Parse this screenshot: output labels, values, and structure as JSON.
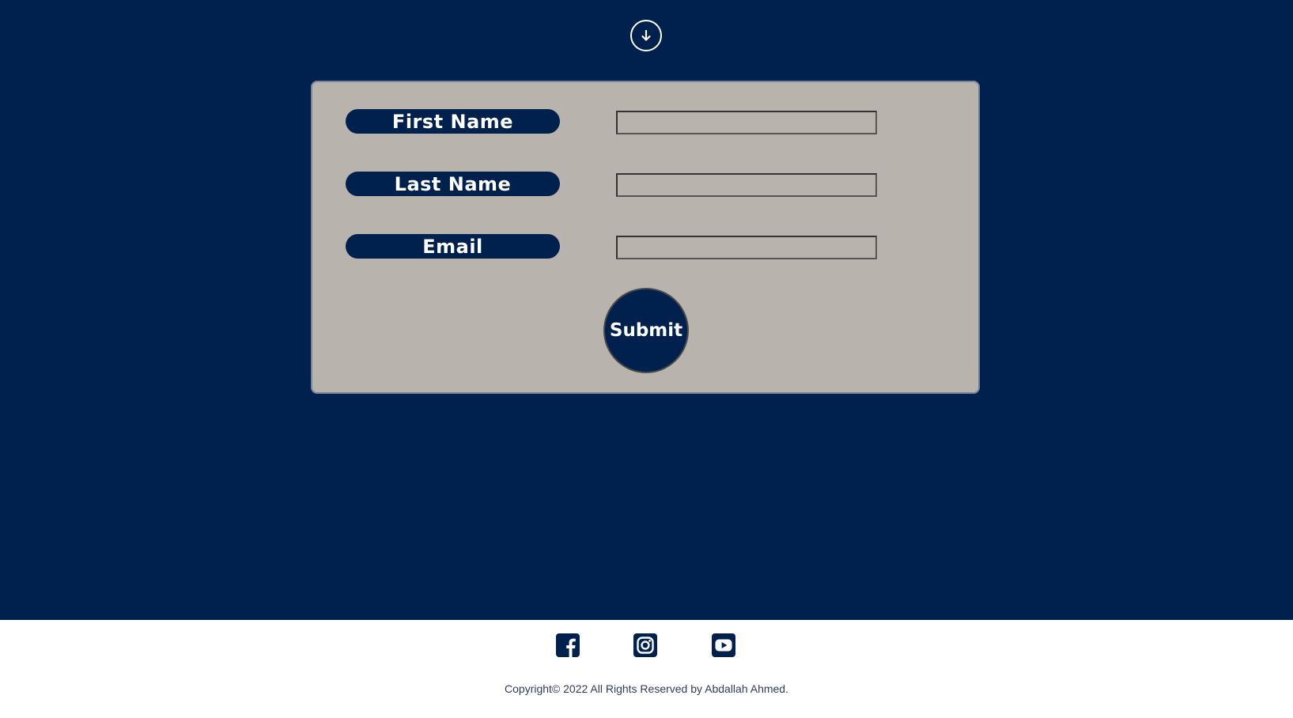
{
  "colors": {
    "primary": "#00204d",
    "card_background": "#b9b3ae",
    "footer_background": "#ffffff"
  },
  "hero": {
    "scroll_icon": "arrow-down-circle-icon"
  },
  "form": {
    "fields": [
      {
        "label": "First Name",
        "value": "",
        "placeholder": ""
      },
      {
        "label": "Last Name",
        "value": "",
        "placeholder": ""
      },
      {
        "label": "Email",
        "value": "",
        "placeholder": ""
      }
    ],
    "submit_label": "Submit"
  },
  "footer": {
    "social_icons": [
      "facebook-icon",
      "instagram-icon",
      "youtube-icon"
    ],
    "copyright": "Copyright© 2022 All Rights Reserved by Abdallah Ahmed."
  }
}
